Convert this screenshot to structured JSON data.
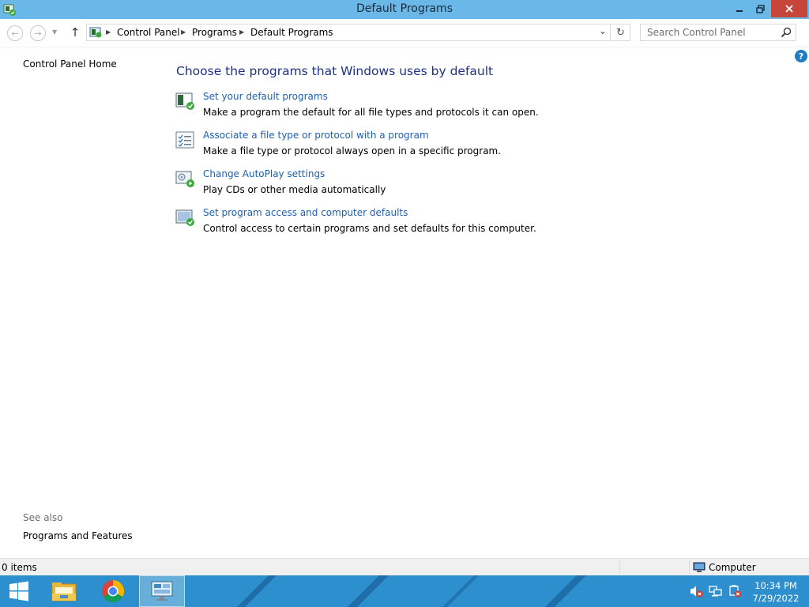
{
  "window": {
    "title": "Default Programs",
    "controls": [
      "minimize",
      "restore",
      "close"
    ]
  },
  "navigation": {
    "breadcrumbs": [
      "Control Panel",
      "Programs",
      "Default Programs"
    ],
    "search_placeholder": "Search Control Panel"
  },
  "sidebar": {
    "home_link": "Control Panel Home",
    "see_also_label": "See also",
    "see_also_links": [
      "Programs and Features"
    ]
  },
  "main": {
    "title": "Choose the programs that Windows uses by default",
    "tasks": [
      {
        "link": "Set your default programs",
        "description": "Make a program the default for all file types and protocols it can open.",
        "icon": "default-programs-icon"
      },
      {
        "link": "Associate a file type or protocol with a program",
        "description": "Make a file type or protocol always open in a specific program.",
        "icon": "file-association-icon"
      },
      {
        "link": "Change AutoPlay settings",
        "description": "Play CDs or other media automatically",
        "icon": "autoplay-icon"
      },
      {
        "link": "Set program access and computer defaults",
        "description": "Control access to certain programs and set defaults for this computer.",
        "icon": "program-access-icon"
      }
    ]
  },
  "statusbar": {
    "items_count": "0 items",
    "location": "Computer"
  },
  "taskbar": {
    "pinned": [
      "start",
      "file-explorer",
      "google-chrome",
      "control-panel"
    ],
    "active": "control-panel",
    "time": "10:34 PM",
    "date": "7/29/2022"
  },
  "colors": {
    "titlebar": "#6ab8e8",
    "taskbar": "#2d8fcd",
    "link": "#1e61ae",
    "heading": "#1e3287",
    "close_button": "#c7463c"
  }
}
